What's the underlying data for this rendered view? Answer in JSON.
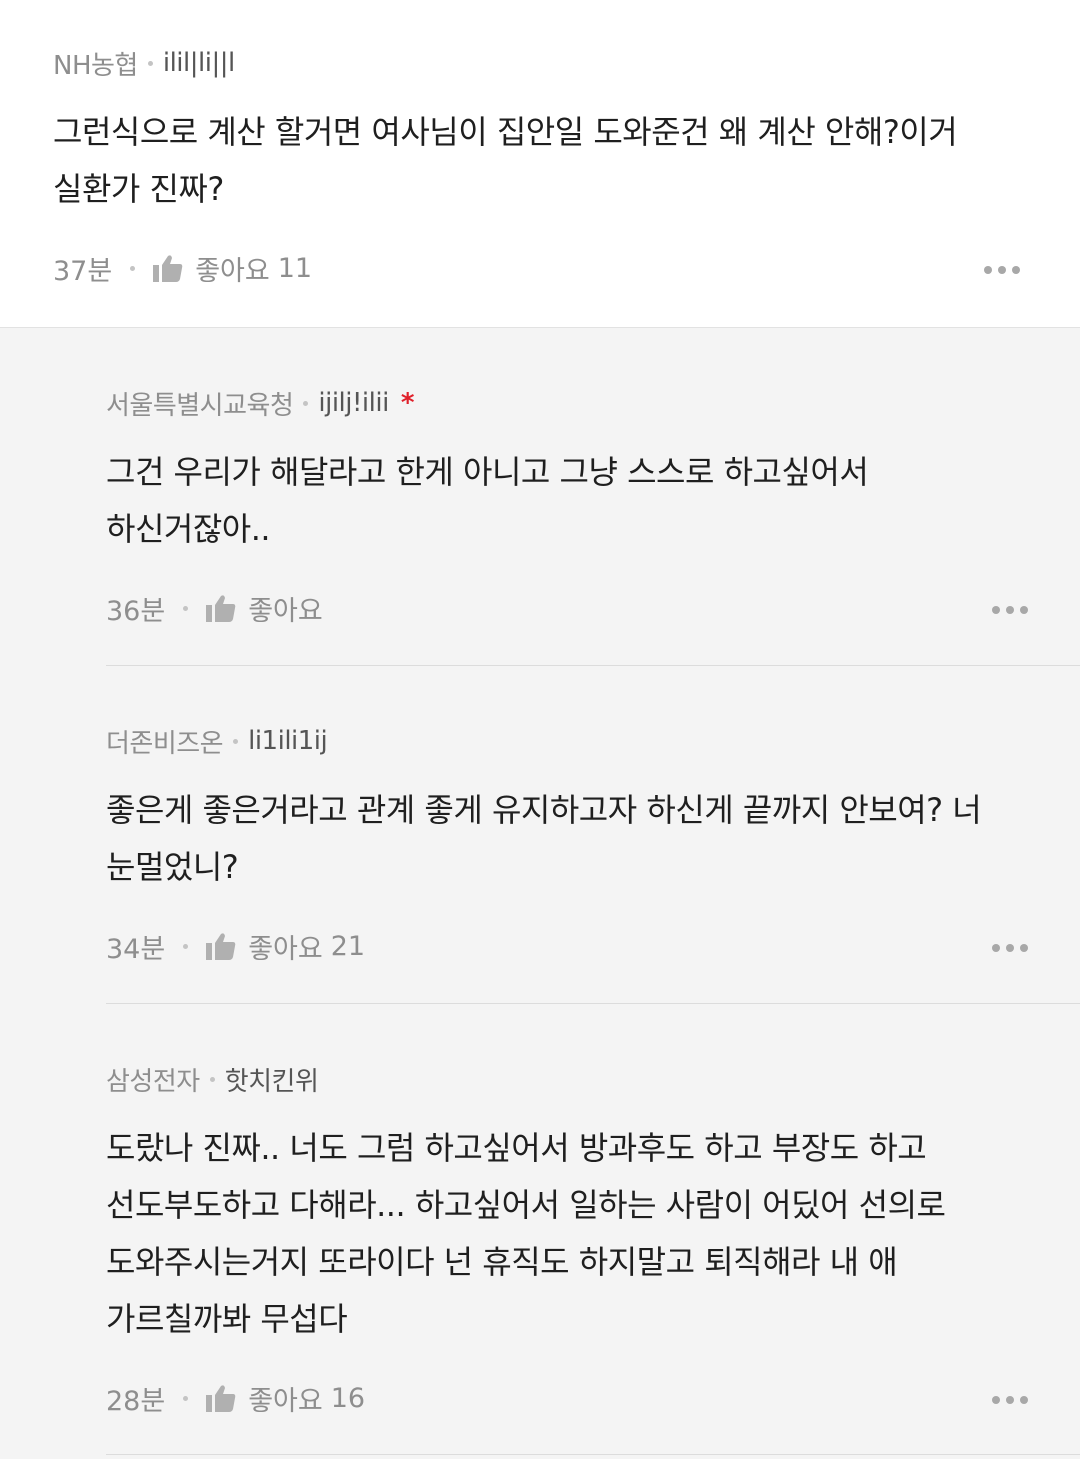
{
  "comments": [
    {
      "company": "NH농협",
      "nickname": "ilil|li||l",
      "is_author": false,
      "body": "그런식으로 계산 할거면 여사님이 집안일 도와준건 왜 계산 안해?이거\n실환가 진짜?",
      "time": "37분",
      "like_label": "좋아요",
      "like_count": "11"
    }
  ],
  "replies": [
    {
      "company": "서울특별시교육청",
      "nickname": "ijilj!ilii",
      "is_author": true,
      "author_mark": "*",
      "body": "그건 우리가 해달라고 한게 아니고 그냥 스스로 하고싶어서\n하신거잖아..",
      "time": "36분",
      "like_label": "좋아요",
      "like_count": ""
    },
    {
      "company": "더존비즈온",
      "nickname": "li1ili1ij",
      "is_author": false,
      "body": "좋은게 좋은거라고 관계 좋게 유지하고자 하신게 끝까지 안보여? 너\n눈멀었니?",
      "time": "34분",
      "like_label": "좋아요",
      "like_count": "21"
    },
    {
      "company": "삼성전자",
      "nickname": "핫치킨위",
      "is_author": false,
      "body": "도랐나 진짜.. 너도 그럼 하고싶어서 방과후도 하고 부장도 하고\n선도부도하고 다해라... 하고싶어서 일하는 사람이 어딨어 선의로\n도와주시는거지 또라이다 넌 휴직도 하지말고 퇴직해라 내 애\n가르칠까봐 무섭다",
      "time": "28분",
      "like_label": "좋아요",
      "like_count": "16"
    }
  ],
  "icons": {
    "like": "thumbs-up-icon",
    "more": "more-dots-icon"
  },
  "colors": {
    "author_mark": "#e0202a",
    "reply_background": "#f4f4f4"
  }
}
